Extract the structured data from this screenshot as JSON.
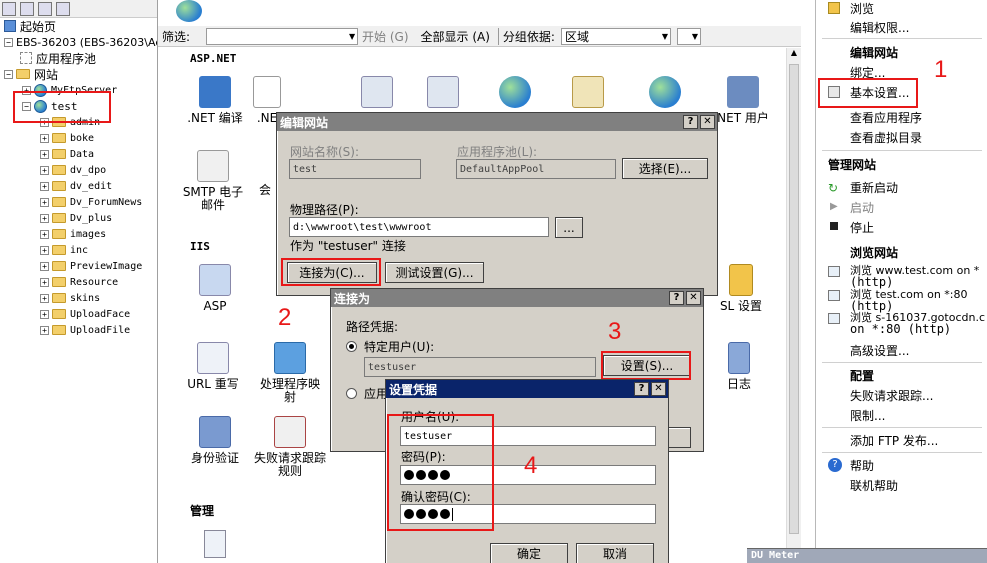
{
  "tree": {
    "start_page": "起始页",
    "server": "EBS-36203 (EBS-36203\\Ad",
    "app_pools": "应用程序池",
    "sites": "网站",
    "ftp_site": "MyFtpServer",
    "selected_site": "test",
    "folders": [
      "admin",
      "boke",
      "Data",
      "dv_dpo",
      "dv_edit",
      "Dv_ForumNews",
      "Dv_plus",
      "images",
      "inc",
      "PreviewImage",
      "Resource",
      "skins",
      "UploadFace",
      "UploadFile"
    ]
  },
  "center": {
    "filter_label": "筛选:",
    "start_label": "开始 (G)",
    "show_all_label": "全部显示 (A)",
    "group_label": "分组依据:",
    "group_value": "区域",
    "section_aspnet": "ASP.NET",
    "section_iis": "IIS",
    "section_manage": "管理",
    "features": {
      "net_compile": ".NET 编译",
      "net_error": ".NE",
      "net_user": "NET 用户",
      "smtp": "SMTP 电子邮件",
      "smtp_trunc": "会",
      "asp": "ASP",
      "ssl": "SL 设置",
      "url_rewrite": "URL 重写",
      "handler": "处理程序映射",
      "log": "日志",
      "auth": "身份验证",
      "failed_req": "失败请求跟踪规则"
    }
  },
  "actions": {
    "browse": "浏览",
    "edit_perm": "编辑权限...",
    "edit_site_h": "编辑网站",
    "bindings": "绑定...",
    "basic_settings": "基本设置...",
    "view_apps": "查看应用程序",
    "view_vdirs": "查看虚拟目录",
    "manage_site_h": "管理网站",
    "restart": "重新启动",
    "start": "启动",
    "stop": "停止",
    "browse_site_h": "浏览网站",
    "browse_1a": "浏览 www.test.com on *",
    "browse_1b": "(http)",
    "browse_2a": "浏览 test.com on *:80",
    "browse_2b": "(http)",
    "browse_3a": "浏览 s-161037.gotocdn.c",
    "browse_3b": "on *:80 (http)",
    "advanced": "高级设置...",
    "config_h": "配置",
    "failed_trace": "失败请求跟踪...",
    "limits": "限制...",
    "add_ftp": "添加 FTP 发布...",
    "help": "帮助",
    "online_help": "联机帮助"
  },
  "edit_site": {
    "title": "编辑网站",
    "site_name_label": "网站名称(S):",
    "site_name_value": "test",
    "app_pool_label": "应用程序池(L):",
    "app_pool_value": "DefaultAppPool",
    "select_button": "选择(E)...",
    "physical_path_label": "物理路径(P):",
    "physical_path_value": "d:\\wwwroot\\test\\wwwroot",
    "browse_button": "...",
    "connect_as_text": "作为 \"testuser\" 连接",
    "connect_as_button": "连接为(C)...",
    "test_settings_button": "测试设置(G)..."
  },
  "connect_as": {
    "title": "连接为",
    "path_credentials": "路径凭据:",
    "specific_user": "特定用户(U):",
    "specific_user_value": "testuser",
    "set_button": "设置(S)...",
    "app_user_trunc": "应用"
  },
  "set_credentials": {
    "title": "设置凭据",
    "username_label": "用户名(U):",
    "username_value": "testuser",
    "password_label": "密码(P):",
    "confirm_label": "确认密码(C):",
    "ok_button": "确定",
    "cancel_button": "取消"
  },
  "annotations": [
    "1",
    "2",
    "3",
    "4"
  ],
  "taskbar_snippet": "DU Meter",
  "colors": {
    "title_active": "#0a246a",
    "title_inactive": "#808080",
    "annotation": "#e81818"
  }
}
